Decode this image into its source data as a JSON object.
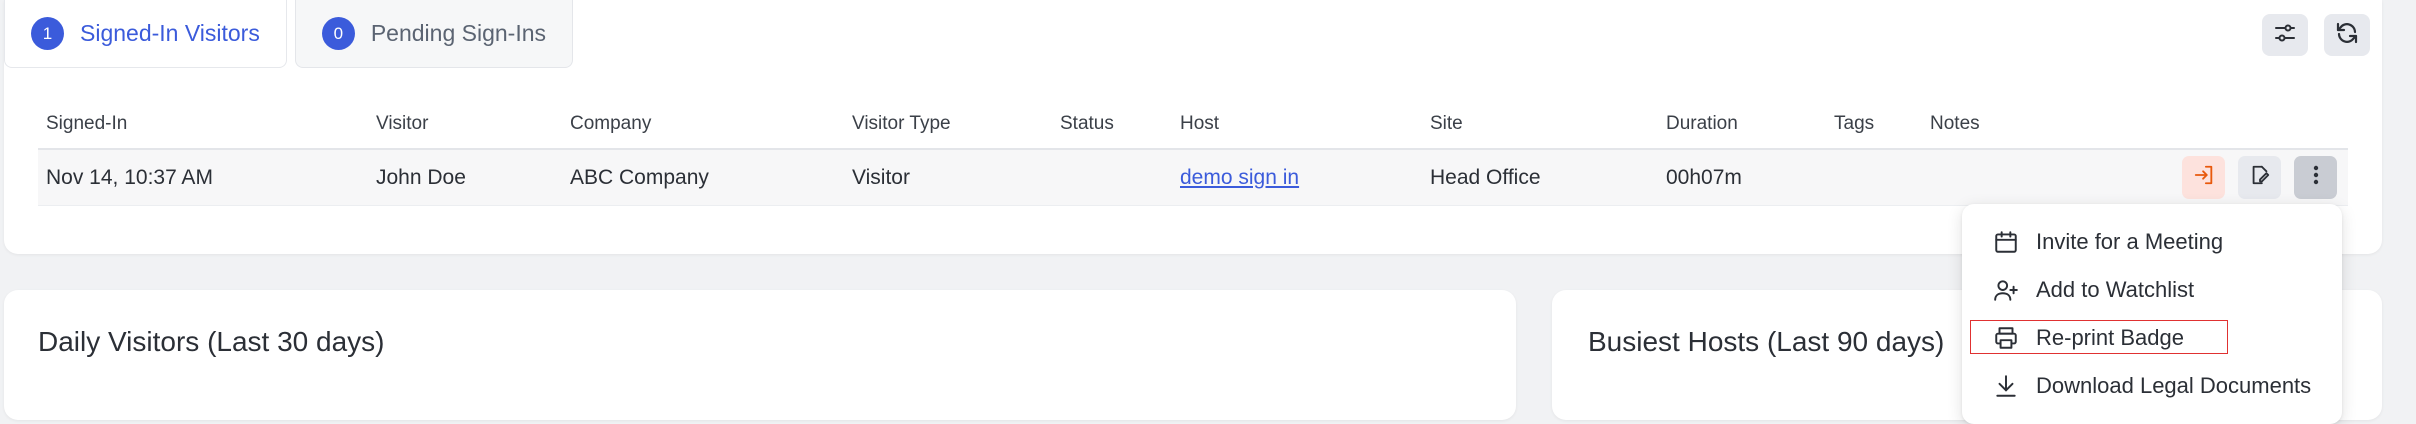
{
  "tabs": [
    {
      "count": "1",
      "label": "Signed-In Visitors",
      "active": true
    },
    {
      "count": "0",
      "label": "Pending Sign-Ins",
      "active": false
    }
  ],
  "toolbar": {
    "filter_icon": "sliders-icon",
    "refresh_icon": "refresh-icon"
  },
  "table": {
    "headers": [
      "Signed-In",
      "Visitor",
      "Company",
      "Visitor Type",
      "Status",
      "Host",
      "Site",
      "Duration",
      "Tags",
      "Notes"
    ],
    "rows": [
      {
        "signed_in": "Nov 14, 10:37 AM",
        "visitor": "John Doe",
        "company": "ABC Company",
        "visitor_type": "Visitor",
        "status": "",
        "host": "demo sign in",
        "site": "Head Office",
        "duration": "00h07m",
        "tags": "",
        "notes": ""
      }
    ]
  },
  "row_actions": [
    "sign-out-icon",
    "edit-icon",
    "more-vertical-icon"
  ],
  "menu": {
    "items": [
      {
        "icon": "calendar-icon",
        "label": "Invite for a Meeting"
      },
      {
        "icon": "user-plus-icon",
        "label": "Add to Watchlist"
      },
      {
        "icon": "printer-icon",
        "label": "Re-print Badge"
      },
      {
        "icon": "download-icon",
        "label": "Download Legal Documents"
      }
    ]
  },
  "cards": {
    "daily_visitors_title": "Daily Visitors (Last 30 days)",
    "busiest_hosts_title": "Busiest Hosts (Last 90 days)"
  },
  "colors": {
    "accent": "#3b5bdb",
    "signout_bg": "#fde2dd",
    "signout_icon": "#e8590c",
    "highlight": "#e03131"
  }
}
